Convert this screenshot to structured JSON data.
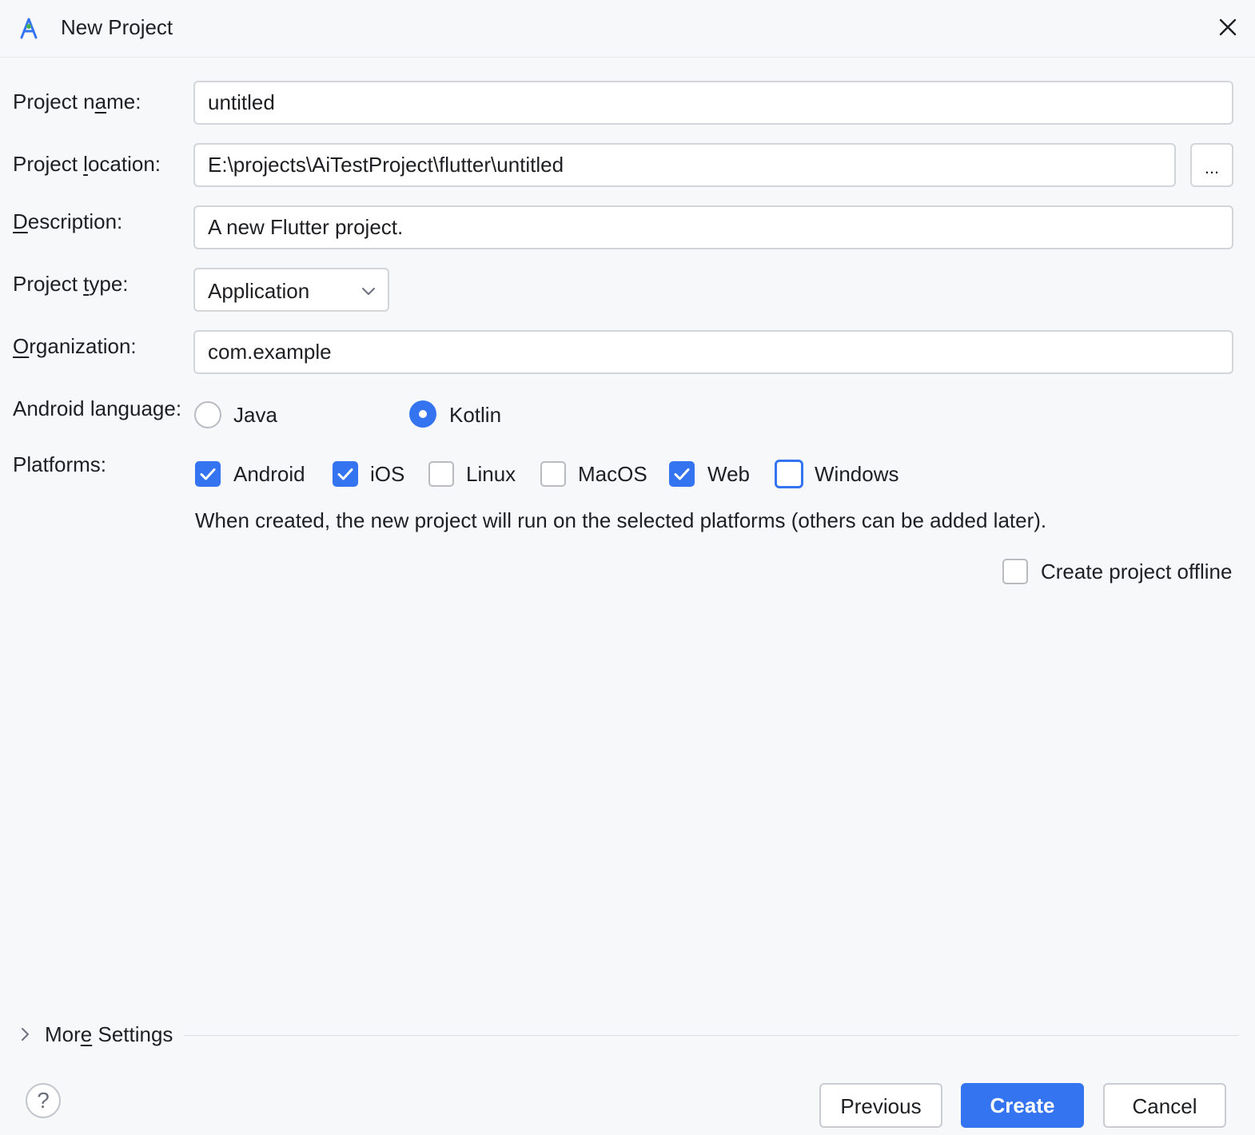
{
  "dialog": {
    "title": "New Project",
    "icon": "android-studio-icon"
  },
  "form": {
    "project_name": {
      "label_before": "Project n",
      "label_mn": "a",
      "label_after": "me:",
      "value": "untitled"
    },
    "project_location": {
      "label_before": "Project ",
      "label_mn": "l",
      "label_after": "ocation:",
      "value": "E:\\projects\\AiTestProject\\flutter\\untitled",
      "browse_label": "..."
    },
    "description": {
      "label_before": "",
      "label_mn": "D",
      "label_after": "escription:",
      "value": "A new Flutter project."
    },
    "project_type": {
      "label_before": "Project ",
      "label_mn": "t",
      "label_after": "ype:",
      "value": "Application"
    },
    "organization": {
      "label_before": "",
      "label_mn": "O",
      "label_after": "rganization:",
      "value": "com.example"
    },
    "android_language": {
      "label": "Android language:",
      "options": [
        {
          "label": "Java",
          "selected": false
        },
        {
          "label": "Kotlin",
          "selected": true
        }
      ]
    },
    "platforms": {
      "label": "Platforms:",
      "options": [
        {
          "label": "Android",
          "checked": true
        },
        {
          "label": "iOS",
          "checked": true
        },
        {
          "label": "Linux",
          "checked": false
        },
        {
          "label": "MacOS",
          "checked": false
        },
        {
          "label": "Web",
          "checked": true
        },
        {
          "label": "Windows",
          "checked": false,
          "focused": true
        }
      ],
      "hint": "When created, the new project will run on the selected platforms (others can be added later)."
    },
    "offline": {
      "label": "Create project offline",
      "checked": false
    }
  },
  "more_settings": {
    "label_before": "Mor",
    "label_mn": "e",
    "label_after": " Settings"
  },
  "footer": {
    "help": "?",
    "previous": "Previous",
    "create": "Create",
    "cancel": "Cancel"
  },
  "colors": {
    "accent": "#3574f0",
    "background": "#f7f8fa",
    "border": "#d3d5db"
  }
}
